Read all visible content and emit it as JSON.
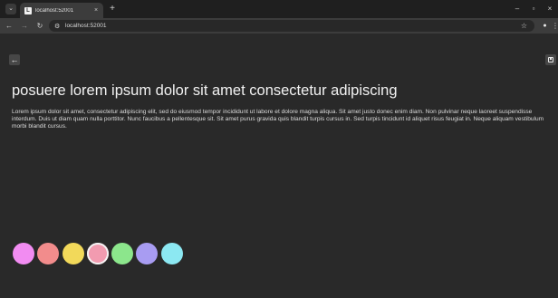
{
  "browser": {
    "tab": {
      "title": "localhost:52001",
      "close_glyph": "×"
    },
    "new_tab_glyph": "+",
    "window_controls": {
      "minimize": "–",
      "maximize": "▫",
      "close": "×"
    },
    "toolbar": {
      "back": "←",
      "forward": "→",
      "reload": "↻"
    },
    "address_bar": {
      "url": "localhost:52001"
    }
  },
  "page": {
    "back_glyph": "←",
    "title": "posuere lorem ipsum dolor sit amet consectetur adipiscing",
    "body": "Lorem ipsum dolor sit amet, consectetur adipiscing elit, sed do eiusmod tempor incididunt ut labore et dolore magna aliqua. Sit amet justo donec enim diam. Non pulvinar neque laoreet suspendisse interdum. Duis ut diam quam nulla porttitor. Nunc faucibus a pellentesque sit. Sit amet purus gravida quis blandit turpis cursus in. Sed turpis tincidunt id aliquet risus feugiat in. Neque aliquam vestibulum morbi blandit cursus.",
    "color_swatches": [
      {
        "color": "#f28cf2",
        "selected": false
      },
      {
        "color": "#f28c8c",
        "selected": false
      },
      {
        "color": "#f2d95a",
        "selected": false
      },
      {
        "color": "#f29bb0",
        "selected": true
      },
      {
        "color": "#8ce68c",
        "selected": false
      },
      {
        "color": "#a89cf2",
        "selected": false
      },
      {
        "color": "#8ce8f2",
        "selected": false
      }
    ]
  }
}
